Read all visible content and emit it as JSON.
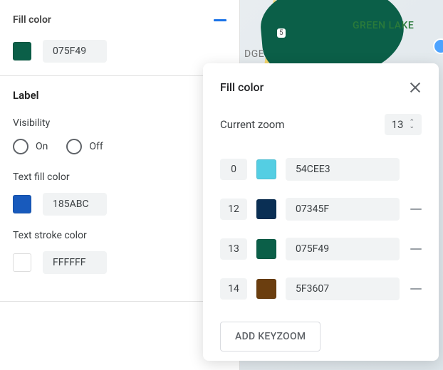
{
  "sidebar": {
    "fill_color": {
      "title": "Fill color",
      "hex": "075F49",
      "swatch": "#0b5f48"
    },
    "label": {
      "title": "Label",
      "visibility_label": "Visibility",
      "on_label": "On",
      "off_label": "Off",
      "text_fill_label": "Text fill color",
      "text_fill_hex": "185ABC",
      "text_fill_swatch": "#185abc",
      "text_stroke_label": "Text stroke color",
      "text_stroke_hex": "FFFFFF",
      "text_stroke_swatch": "#ffffff"
    }
  },
  "map": {
    "green_lake_label": "GREEN LAKE",
    "dge_label": "DGE",
    "road_shield": "5"
  },
  "popup": {
    "title": "Fill color",
    "zoom_label": "Current zoom",
    "zoom_value": "13",
    "stops": [
      {
        "zoom": "0",
        "hex": "54CEE3",
        "swatch": "#54cee3",
        "removable": false
      },
      {
        "zoom": "12",
        "hex": "07345F",
        "swatch": "#0a2f54",
        "removable": true
      },
      {
        "zoom": "13",
        "hex": "075F49",
        "swatch": "#0b5f48",
        "removable": true
      },
      {
        "zoom": "14",
        "hex": "5F3607",
        "swatch": "#6b3e0f",
        "removable": true
      }
    ],
    "add_label": "ADD KEYZOOM"
  }
}
